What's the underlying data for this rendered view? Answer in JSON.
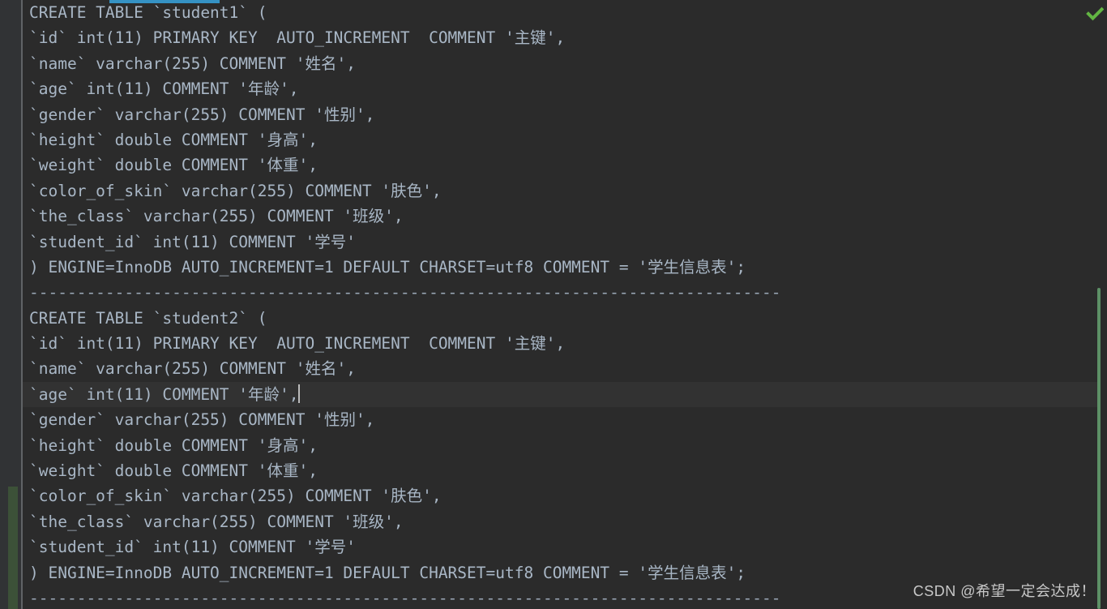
{
  "theme": {
    "editor_background": "#2b2b2b",
    "gutter_background": "#313335",
    "text_color": "#a9b7c6",
    "current_line_background": "#323232",
    "accent_blue": "#3592c4",
    "status_ok_green": "#62b543",
    "scrollbar_green": "#5d9066",
    "change_marker_green": "#3c5138"
  },
  "editor": {
    "lines": [
      {
        "text": "CREATE TABLE `student1` (",
        "current": false
      },
      {
        "text": "`id` int(11) PRIMARY KEY  AUTO_INCREMENT  COMMENT '主键',",
        "current": false
      },
      {
        "text": "`name` varchar(255) COMMENT '姓名',",
        "current": false
      },
      {
        "text": "`age` int(11) COMMENT '年龄',",
        "current": false
      },
      {
        "text": "`gender` varchar(255) COMMENT '性别',",
        "current": false
      },
      {
        "text": "`height` double COMMENT '身高',",
        "current": false
      },
      {
        "text": "`weight` double COMMENT '体重',",
        "current": false
      },
      {
        "text": "`color_of_skin` varchar(255) COMMENT '肤色',",
        "current": false
      },
      {
        "text": "`the_class` varchar(255) COMMENT '班级',",
        "current": false
      },
      {
        "text": "`student_id` int(11) COMMENT '学号'",
        "current": false
      },
      {
        "text": ") ENGINE=InnoDB AUTO_INCREMENT=1 DEFAULT CHARSET=utf8 COMMENT = '学生信息表';",
        "current": false
      },
      {
        "text": "-------------------------------------------------------------------------------",
        "current": false
      },
      {
        "text": "CREATE TABLE `student2` (",
        "current": false
      },
      {
        "text": "`id` int(11) PRIMARY KEY  AUTO_INCREMENT  COMMENT '主键',",
        "current": false
      },
      {
        "text": "`name` varchar(255) COMMENT '姓名',",
        "current": false
      },
      {
        "text": "`age` int(11) COMMENT '年龄',",
        "current": true,
        "caret": true
      },
      {
        "text": "`gender` varchar(255) COMMENT '性别',",
        "current": false
      },
      {
        "text": "`height` double COMMENT '身高',",
        "current": false
      },
      {
        "text": "`weight` double COMMENT '体重',",
        "current": false
      },
      {
        "text": "`color_of_skin` varchar(255) COMMENT '肤色',",
        "current": false
      },
      {
        "text": "`the_class` varchar(255) COMMENT '班级',",
        "current": false
      },
      {
        "text": "`student_id` int(11) COMMENT '学号'",
        "current": false
      },
      {
        "text": ") ENGINE=InnoDB AUTO_INCREMENT=1 DEFAULT CHARSET=utf8 COMMENT = '学生信息表';",
        "current": false
      },
      {
        "text": "-------------------------------------------------------------------------------",
        "current": false
      }
    ]
  },
  "status": {
    "inspection_icon": "check-icon",
    "inspection_state": "ok"
  },
  "scrollbar": {
    "orientation": "vertical",
    "thumb_color": "#5d9066"
  },
  "watermark": {
    "text": "CSDN @希望一定会达成！"
  }
}
